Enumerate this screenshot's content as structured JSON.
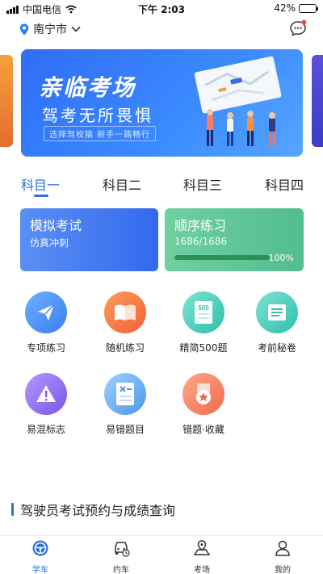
{
  "status_bar": {
    "carrier": "中国电信",
    "time": "下午 2:03",
    "battery_pct": "42%",
    "battery_level": 0.42
  },
  "header": {
    "city": "南宁市",
    "location_icon": "location-pin-icon",
    "dropdown_icon": "chevron-down-icon",
    "message_icon": "chat-bubble-icon"
  },
  "banner": {
    "title": "亲临考场",
    "subtitle": "驾考无所畏惧",
    "tagline": "选择驾校猫  新手一路畅行"
  },
  "tabs": [
    "科目一",
    "科目二",
    "科目三",
    "科目四"
  ],
  "cards": {
    "mock": {
      "title": "模拟考试",
      "subtitle": "仿真冲刺"
    },
    "order": {
      "title": "顺序练习",
      "progress_text": "1686/1686",
      "percent": "100%",
      "progress": 1.0
    }
  },
  "features": [
    {
      "label": "专项练习",
      "icon": "paper-plane-icon",
      "color": "#4a8ff0"
    },
    {
      "label": "随机练习",
      "icon": "open-book-icon",
      "color": "#f0743c"
    },
    {
      "label": "精简500题",
      "icon": "question-sheet-icon",
      "color": "#3fc9b4"
    },
    {
      "label": "考前秘卷",
      "icon": "scroll-icon",
      "color": "#3fc9b4"
    },
    {
      "label": "易混标志",
      "icon": "warning-sign-icon",
      "color": "#8e6cf0"
    },
    {
      "label": "易错题目",
      "icon": "wrong-answer-icon",
      "color": "#5aa2ee"
    },
    {
      "label": "错题·收藏",
      "icon": "star-badge-icon",
      "color": "#f07a5a"
    }
  ],
  "section_title": "驾驶员考试预约与成绩查询",
  "bottom_nav": [
    {
      "label": "学车",
      "icon": "steering-wheel-icon"
    },
    {
      "label": "约车",
      "icon": "car-icon"
    },
    {
      "label": "考场",
      "icon": "map-pin-icon"
    },
    {
      "label": "我的",
      "icon": "person-icon"
    }
  ]
}
